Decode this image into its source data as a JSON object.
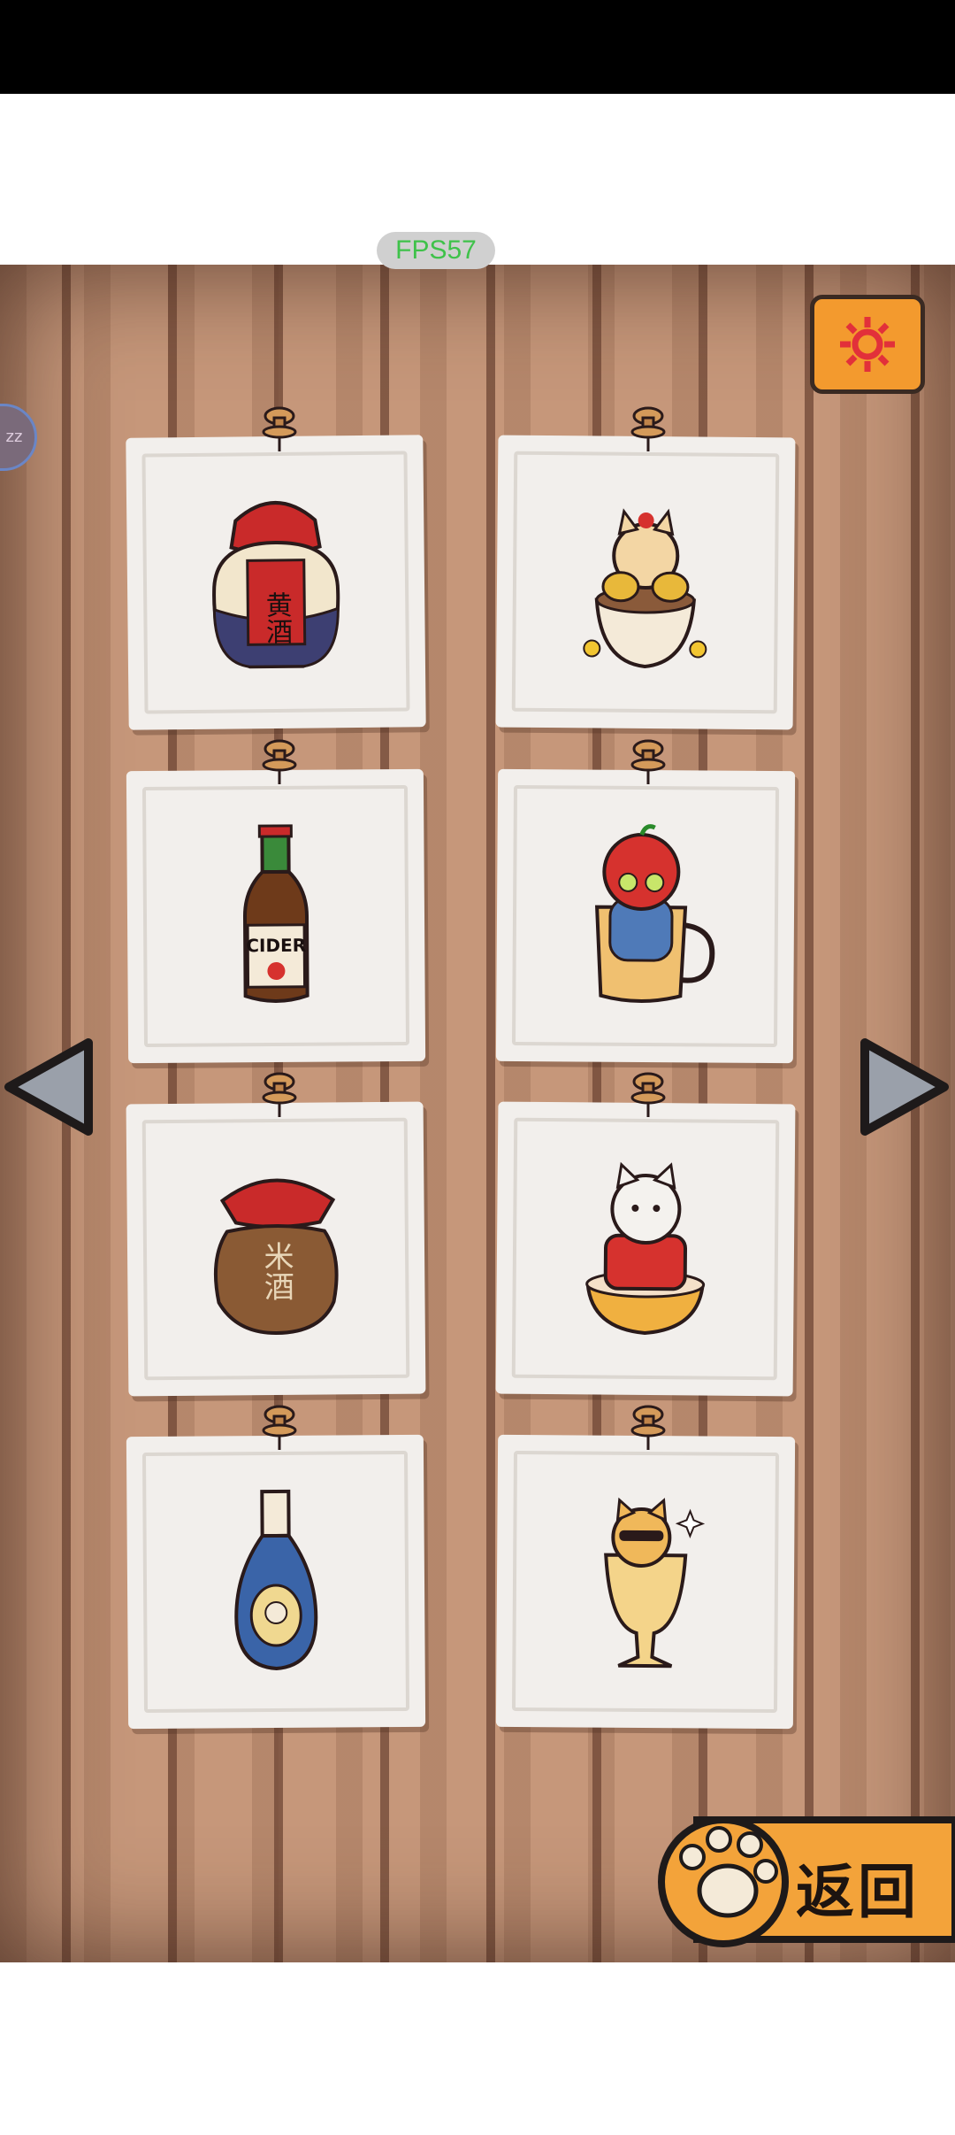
{
  "overlay": {
    "fps_text": "FPS57",
    "side_badge_text": "zz"
  },
  "buttons": {
    "back_label": "返回",
    "settings_icon": "gear-icon",
    "prev_icon": "triangle-left-icon",
    "next_icon": "triangle-right-icon"
  },
  "items": [
    {
      "name": "yellow-wine-jar",
      "label": "黄酒"
    },
    {
      "name": "cat-in-golden-cup"
    },
    {
      "name": "cider-bottle",
      "label": "CIDER"
    },
    {
      "name": "apple-cat-in-mug"
    },
    {
      "name": "rice-wine-jar",
      "label": "米酒"
    },
    {
      "name": "cat-in-red-coat-bowl"
    },
    {
      "name": "blue-liquor-bottle"
    },
    {
      "name": "cat-in-beer-glass"
    }
  ],
  "colors": {
    "wood": "#c6977a",
    "paper": "#f2efec",
    "accent_orange": "#f39a2e",
    "fps_green": "#3fc24a"
  }
}
